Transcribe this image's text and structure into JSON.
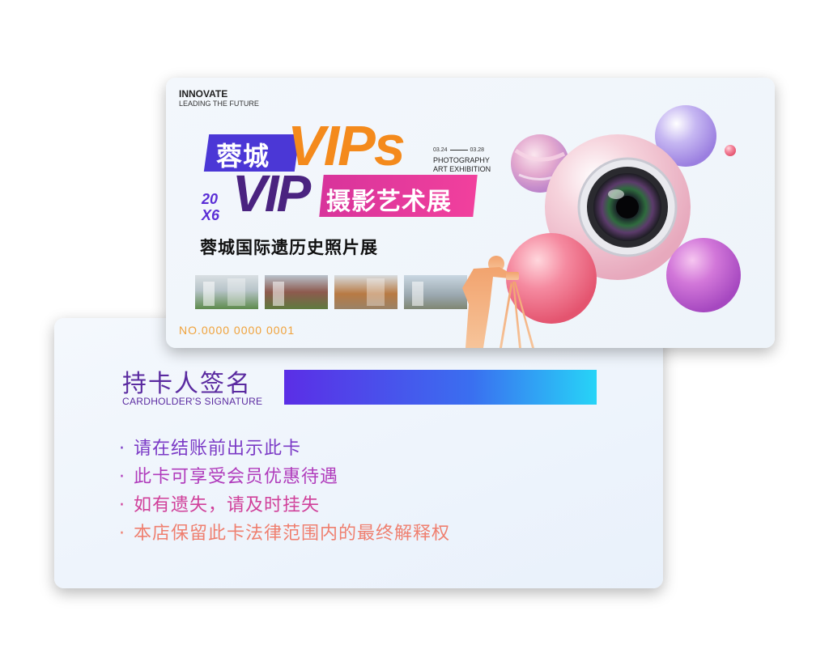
{
  "back_card": {
    "signature_title": "持卡人签名",
    "signature_subtitle": "CARDHOLDER'S SIGNATURE",
    "rules": [
      "请在结账前出示此卡",
      "此卡可享受会员优惠待遇",
      "如有遗失，请及时挂失",
      "本店保留此卡法律范围内的最终解释权"
    ],
    "bullet": "·"
  },
  "front_card": {
    "tagline_top": "INNOVATE",
    "tagline_bottom": "LEADING THE FUTURE",
    "city": "蓉城",
    "vips": "VIPs",
    "vip": "VIP",
    "year_top": "20",
    "year_bottom": "X6",
    "exhibition": "摄影艺术展",
    "date_start": "03.24",
    "date_end": "03.28",
    "photo_en_1": "PHOTOGRAPHY",
    "photo_en_2": "ART EXHIBITION",
    "history_title": "蓉城国际遗历史照片展",
    "card_number": "NO.0000  0000 0001"
  },
  "colors": {
    "purple": "#4b37d6",
    "orange": "#f48a1c",
    "magenta": "#e03a9a",
    "signature_gradient_start": "#5b2ee6",
    "signature_gradient_end": "#27d4f7"
  }
}
